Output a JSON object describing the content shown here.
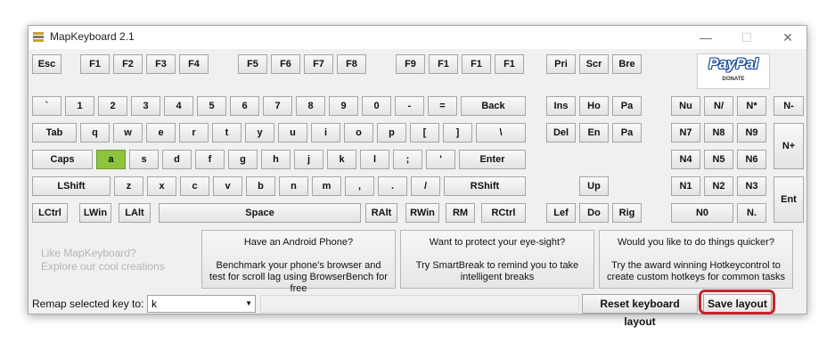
{
  "window": {
    "title": "MapKeyboard 2.1",
    "controls": {
      "minimize": "—",
      "maximize": "☐",
      "close": "✕"
    }
  },
  "keys": {
    "esc": "Esc",
    "f": [
      "F1",
      "F2",
      "F3",
      "F4",
      "F5",
      "F6",
      "F7",
      "F8",
      "F9",
      "F1",
      "F1",
      "F1"
    ],
    "pri": "Pri",
    "scr": "Scr",
    "bre": "Bre",
    "num_row": [
      "`",
      "1",
      "2",
      "3",
      "4",
      "5",
      "6",
      "7",
      "8",
      "9",
      "0",
      "-",
      "="
    ],
    "back": "Back",
    "tab": "Tab",
    "q_row": [
      "q",
      "w",
      "e",
      "r",
      "t",
      "y",
      "u",
      "i",
      "o",
      "p",
      "[",
      "]",
      "\\"
    ],
    "caps": "Caps",
    "a_row": [
      "a",
      "s",
      "d",
      "f",
      "g",
      "h",
      "j",
      "k",
      "l",
      ";",
      "'"
    ],
    "enter": "Enter",
    "lshift": "LShift",
    "z_row": [
      "z",
      "x",
      "c",
      "v",
      "b",
      "n",
      "m",
      ",",
      ".",
      "/"
    ],
    "rshift": "RShift",
    "lctrl": "LCtrl",
    "lwin": "LWin",
    "lalt": "LAlt",
    "space": "Space",
    "ralt": "RAlt",
    "rwin": "RWin",
    "rm": "RM",
    "rctrl": "RCtrl",
    "ins": "Ins",
    "ho": "Ho",
    "pa1": "Pa",
    "del": "Del",
    "en": "En",
    "pa2": "Pa",
    "up": "Up",
    "left": "Lef",
    "down": "Do",
    "right": "Rig",
    "numpad": {
      "nu": "Nu",
      "div": "N/",
      "mul": "N*",
      "minus": "N-",
      "n7": "N7",
      "n8": "N8",
      "n9": "N9",
      "plus": "N+",
      "n4": "N4",
      "n5": "N5",
      "n6": "N6",
      "n1": "N1",
      "n2": "N2",
      "n3": "N3",
      "ent": "Ent",
      "n0": "N0",
      "dot": "N."
    }
  },
  "selected_key": "a",
  "paypal": {
    "brand": "PayPal",
    "sub": "DONATE"
  },
  "promo": {
    "line1": "Like MapKeyboard?",
    "line2": "Explore our cool creations"
  },
  "panels": [
    {
      "heading": "Have an Android Phone?",
      "body": "Benchmark your phone's browser and test for scroll lag using BrowserBench for free"
    },
    {
      "heading": "Want to protect your eye-sight?",
      "body": "Try SmartBreak to remind you to take intelligent breaks"
    },
    {
      "heading": "Would you like to do things quicker?",
      "body": "Try the award winning Hotkeycontrol to create custom hotkeys for common tasks"
    }
  ],
  "bottom": {
    "remap_label": "Remap selected key to:",
    "remap_value": "k",
    "reset_label": "Reset keyboard layout",
    "save_label": "Save layout"
  },
  "colors": {
    "selected_key": "#8cc43c",
    "highlight": "#c4232e"
  }
}
